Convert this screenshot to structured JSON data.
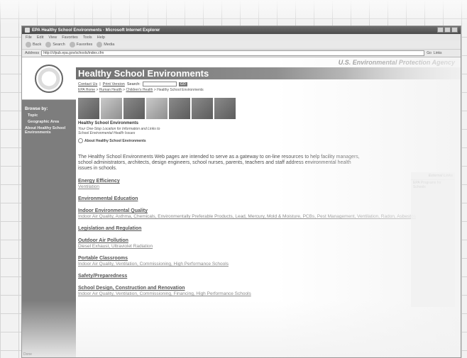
{
  "window": {
    "title": "EPA Healthy School Environments - Microsoft Internet Explorer",
    "menu": [
      "File",
      "Edit",
      "View",
      "Favorites",
      "Tools",
      "Help"
    ],
    "toolbar": [
      "Back",
      "Search",
      "Favorites",
      "Media"
    ],
    "address_label": "Address",
    "address_value": "http://cfpub.epa.gov/schools/index.cfm",
    "go": "Go",
    "links": "Links",
    "status": "Done"
  },
  "nav": {
    "browse_by": "Browse by:",
    "items": [
      "Topic",
      "Geographic Area"
    ],
    "about": "About Healthy School Environments"
  },
  "header": {
    "agency": "U.S. Environmental Protection Agency",
    "title": "Healthy School Environments",
    "contact": "Contact Us",
    "print": "Print Version",
    "search_label": "Search:",
    "search_btn": "GO",
    "breadcrumb": [
      "EPA Home",
      "Human Health",
      "Children's Health",
      "Healthy School Environments"
    ]
  },
  "body": {
    "section_title": "Healthy School Environments",
    "tagline": "Your One-Stop Location for Information and Links to School Environmental Health Issues",
    "about_link": "About Healthy School Environments",
    "intro": "The Healthy School Environments Web pages are intended to serve as a gateway to on-line resources to help facility managers, school administrators, architects, design engineers, school nurses, parents, teachers and staff address environmental health issues in schools.",
    "topics": [
      {
        "heading": "Energy Efficiency",
        "links": "Ventilation"
      },
      {
        "heading": "Environmental Education",
        "links": ""
      },
      {
        "heading": "Indoor Environmental Quality",
        "links": "Indoor Air Quality, Asthma, Chemicals, Environmentally Preferable Products, Lead, Mercury, Mold & Moisture, PCBs, Pest Management, Ventilation, Radon, Asbestos"
      },
      {
        "heading": "Legislation and Regulation",
        "links": ""
      },
      {
        "heading": "Outdoor Air Pollution",
        "links": "Diesel Exhaust, Ultraviolet Radiation"
      },
      {
        "heading": "Portable Classrooms",
        "links": "Indoor Air Quality, Ventilation, Commissioning, High Performance Schools"
      },
      {
        "heading": "Safety/Preparedness",
        "links": ""
      },
      {
        "heading": "School Design, Construction and Renovation",
        "links": "Indoor Air Quality, Ventilation, Commissioning, Financing, High Performance Schools"
      }
    ]
  },
  "right_sidebar": {
    "title": "External Links",
    "items": [
      "EPA Programs for Schools"
    ]
  }
}
